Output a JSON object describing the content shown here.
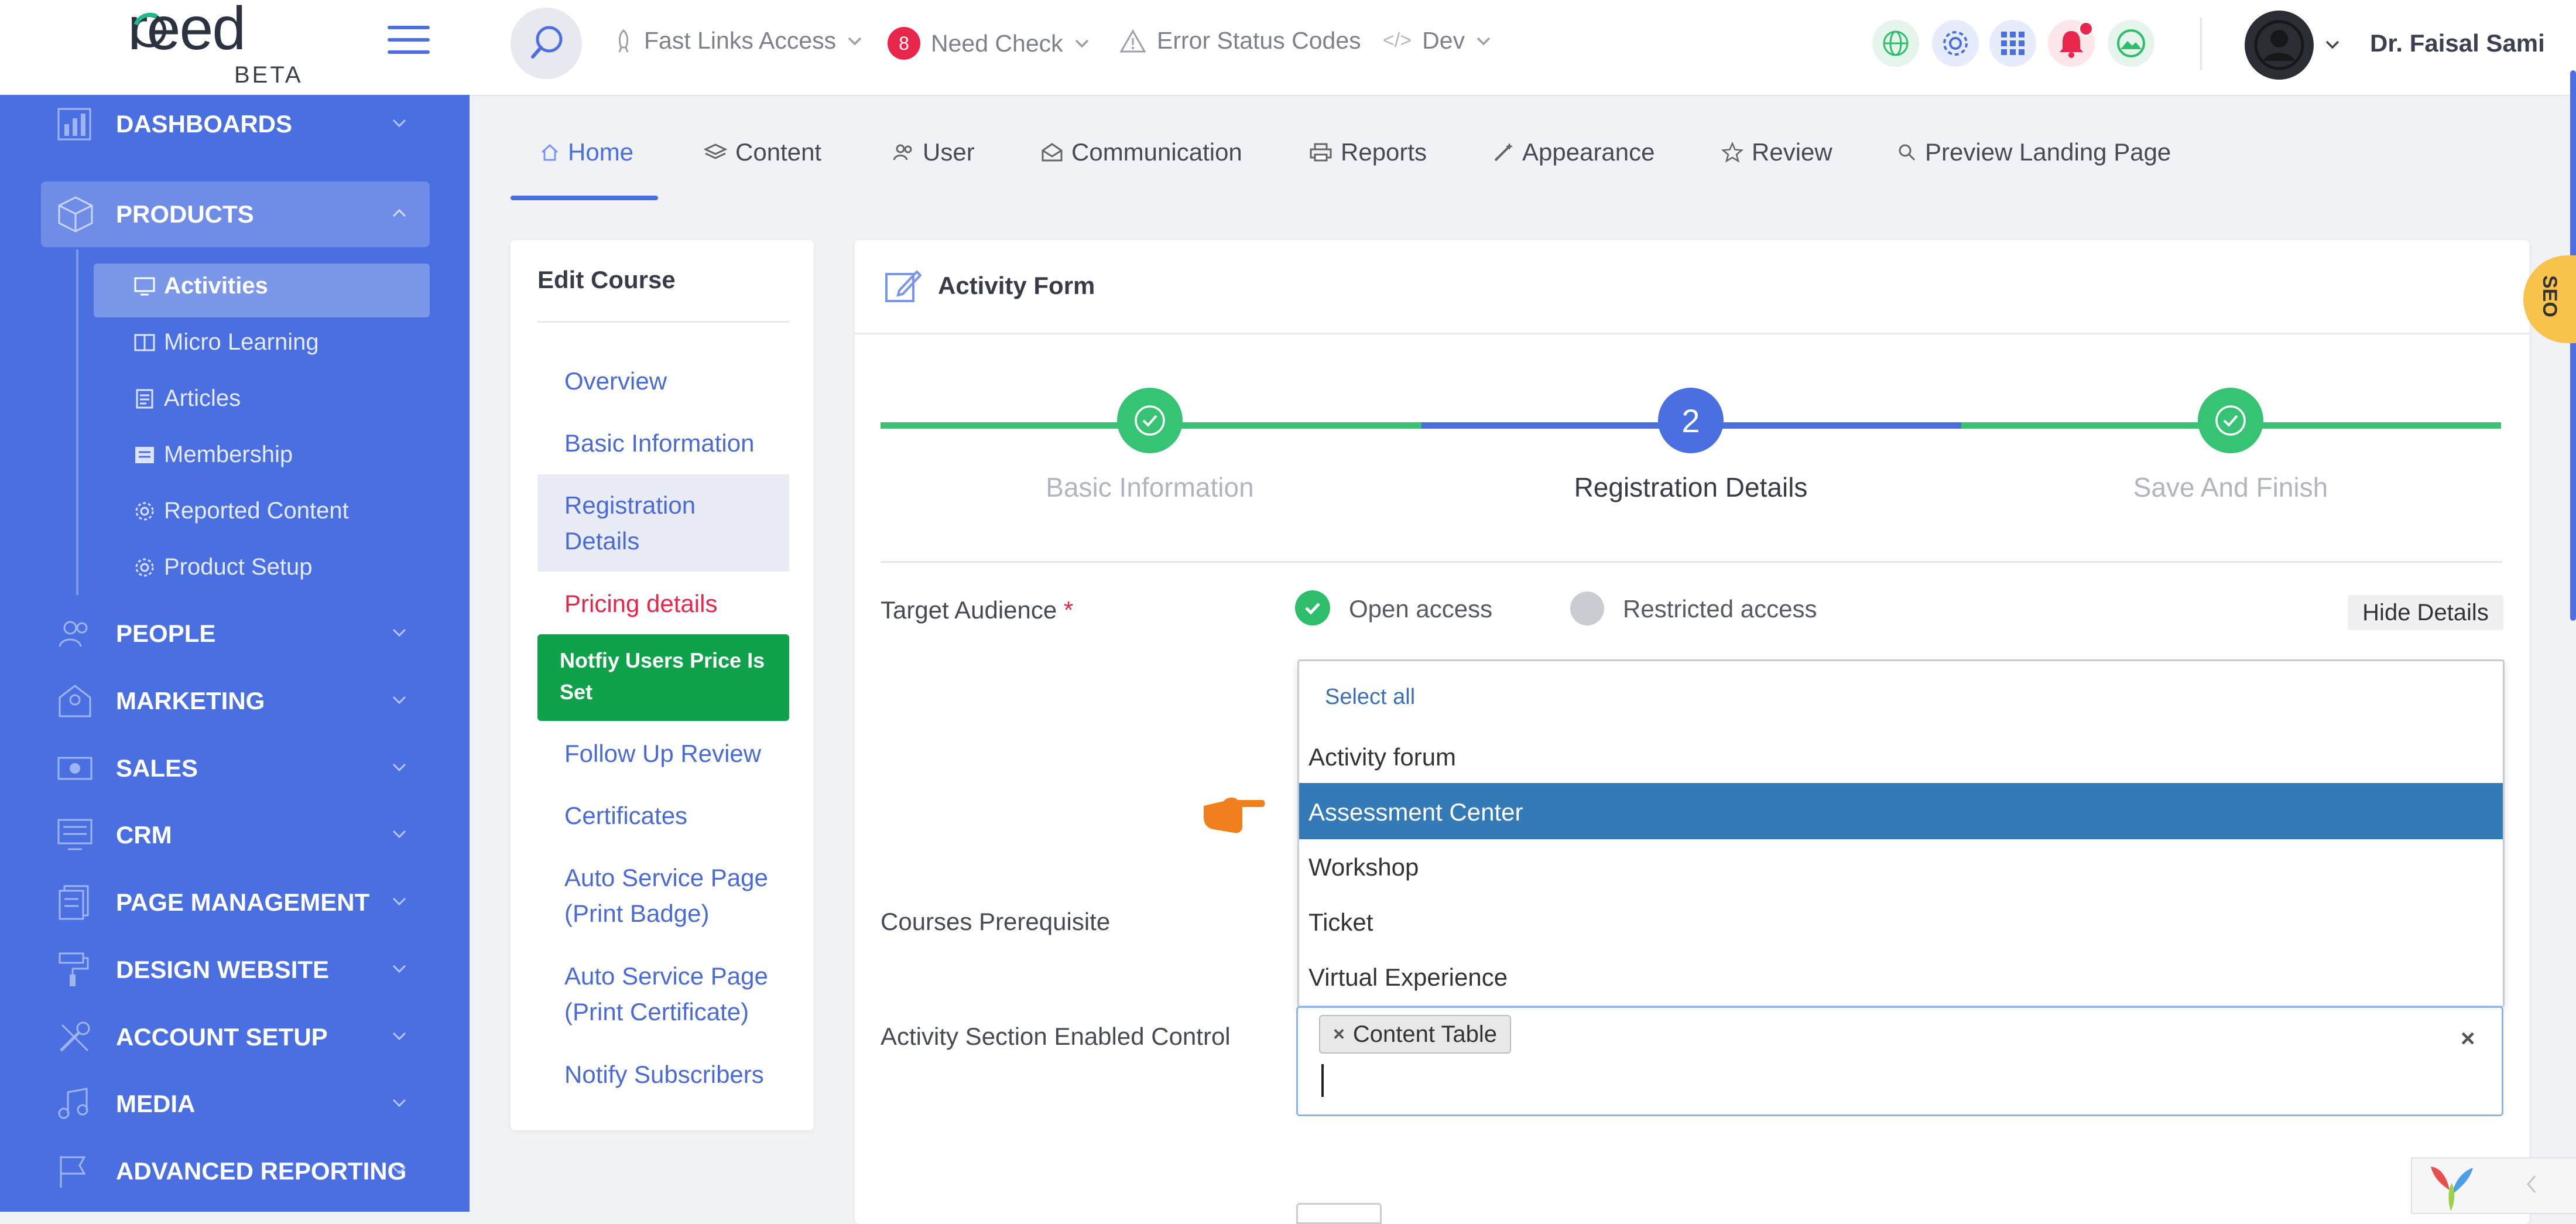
{
  "topbar": {
    "logo": "reed",
    "logo_badge": "BETA",
    "fast_links": "Fast Links Access",
    "need_check_count": "8",
    "need_check": "Need Check",
    "error_codes": "Error Status Codes",
    "dev": "Dev",
    "user_name": "Dr. Faisal Sami"
  },
  "sidebar": {
    "items": [
      {
        "label": "DASHBOARDS"
      },
      {
        "label": "PRODUCTS"
      },
      {
        "label": "PEOPLE"
      },
      {
        "label": "MARKETING"
      },
      {
        "label": "SALES"
      },
      {
        "label": "CRM"
      },
      {
        "label": "PAGE MANAGEMENT"
      },
      {
        "label": "DESIGN WEBSITE"
      },
      {
        "label": "ACCOUNT SETUP"
      },
      {
        "label": "MEDIA"
      },
      {
        "label": "ADVANCED REPORTING"
      }
    ],
    "products_sub": [
      {
        "label": "Activities"
      },
      {
        "label": "Micro Learning"
      },
      {
        "label": "Articles"
      },
      {
        "label": "Membership"
      },
      {
        "label": "Reported Content"
      },
      {
        "label": "Product Setup"
      }
    ]
  },
  "tabs": [
    {
      "label": "Home"
    },
    {
      "label": "Content"
    },
    {
      "label": "User"
    },
    {
      "label": "Communication"
    },
    {
      "label": "Reports"
    },
    {
      "label": "Appearance"
    },
    {
      "label": "Review"
    },
    {
      "label": "Preview Landing Page"
    }
  ],
  "edit_course": {
    "title": "Edit Course",
    "links": [
      {
        "label": "Overview"
      },
      {
        "label": "Basic Information"
      },
      {
        "label": "Registration Details"
      },
      {
        "label": "Pricing details"
      },
      {
        "label": "Notfiy Users Price Is Set"
      },
      {
        "label": "Follow Up Review"
      },
      {
        "label": "Certificates"
      },
      {
        "label": "Auto Service Page (Print Badge)"
      },
      {
        "label": "Auto Service Page (Print Certificate)"
      },
      {
        "label": "Notify Subscribers"
      }
    ]
  },
  "form": {
    "title": "Activity Form",
    "steps": [
      {
        "label": "Basic Information",
        "number": ""
      },
      {
        "label": "Registration Details",
        "number": "2"
      },
      {
        "label": "Save And Finish",
        "number": ""
      }
    ],
    "target_audience_label": "Target Audience",
    "required_mark": "*",
    "open_access": "Open access",
    "restricted_access": "Restricted access",
    "hide_details": "Hide Details",
    "courses_prereq_label": "Courses Prerequisite",
    "section_control_label": "Activity Section Enabled Control",
    "chip": "Content Table",
    "dropdown": {
      "select_all": "Select all",
      "options": [
        {
          "label": "Activity forum"
        },
        {
          "label": "Assessment Center"
        },
        {
          "label": "Workshop"
        },
        {
          "label": "Ticket"
        },
        {
          "label": "Virtual Experience"
        }
      ]
    }
  },
  "seo_tab": "SEO",
  "colors": {
    "sidebar": "#4a6fe0",
    "accent_blue": "#4a6fe0",
    "success_green": "#2ebd6b",
    "button_green": "#10a24b",
    "highlight": "#337ab7",
    "pricing_red": "#e8254a"
  }
}
